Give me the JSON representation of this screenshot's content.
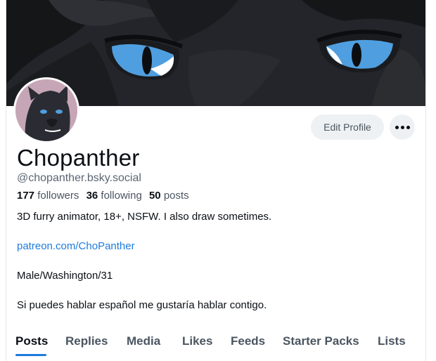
{
  "profile": {
    "display_name": "Chopanther",
    "handle": "@chopanther.bsky.social"
  },
  "actions": {
    "edit_profile_label": "Edit Profile",
    "more_icon": "ellipsis-icon"
  },
  "stats": {
    "followers_count": "177",
    "followers_label": "followers",
    "following_count": "36",
    "following_label": "following",
    "posts_count": "50",
    "posts_label": "posts"
  },
  "bio": {
    "line1": "3D furry animator, 18+, NSFW. I also draw sometimes.",
    "link": "patreon.com/ChoPanther",
    "line3": "Male/Washington/31",
    "line4": "Si puedes hablar español me gustaría hablar contigo."
  },
  "tabs": [
    {
      "label": "Posts",
      "active": true
    },
    {
      "label": "Replies"
    },
    {
      "label": "Media"
    },
    {
      "label": "Likes"
    },
    {
      "label": "Feeds"
    },
    {
      "label": "Starter Packs"
    },
    {
      "label": "Lists"
    }
  ],
  "colors": {
    "accent": "#1d7bde",
    "banner_dark": "#1f2023",
    "eye_blue": "#4f9fe0"
  }
}
